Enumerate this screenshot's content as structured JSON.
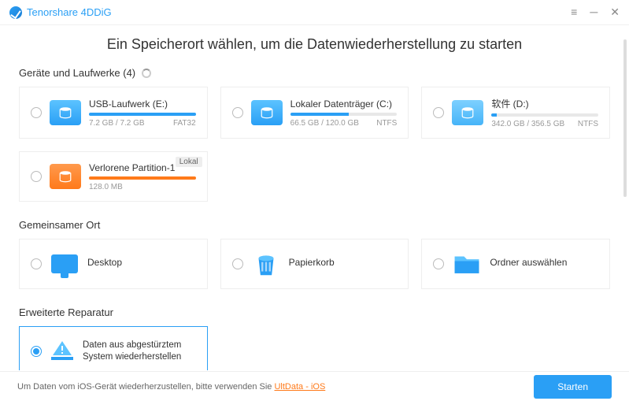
{
  "brand": "Tenorshare 4DDiG",
  "title": "Ein Speicherort wählen, um die Datenwiederherstellung zu starten",
  "sections": {
    "drives_head": "Geräte und Laufwerke (4)",
    "common_head": "Gemeinsamer Ort",
    "advanced_head": "Erweiterte Reparatur"
  },
  "drives": [
    {
      "name": "USB-Laufwerk (E:)",
      "size": "7.2 GB / 7.2 GB",
      "fs": "FAT32",
      "fill": 100,
      "color": "f-blue",
      "iconCls": "di-usb",
      "badge": ""
    },
    {
      "name": "Lokaler Datenträger (C:)",
      "size": "66.5 GB / 120.0 GB",
      "fs": "NTFS",
      "fill": 55,
      "color": "f-blue",
      "iconCls": "di-local",
      "badge": ""
    },
    {
      "name": "软件 (D:)",
      "size": "342.0 GB / 356.5 GB",
      "fs": "NTFS",
      "fill": 5,
      "color": "f-blue",
      "iconCls": "di-soft",
      "badge": ""
    },
    {
      "name": "Verlorene Partition-1",
      "size": "128.0 MB",
      "fs": "",
      "fill": 100,
      "color": "f-orange",
      "iconCls": "di-lost",
      "badge": "Lokal"
    }
  ],
  "common": [
    {
      "name": "Desktop",
      "icon": "monitor"
    },
    {
      "name": "Papierkorb",
      "icon": "trash"
    },
    {
      "name": "Ordner auswählen",
      "icon": "folder"
    }
  ],
  "advanced": {
    "text": "Daten aus abgestürztem System wiederherstellen",
    "selected": true
  },
  "footer": {
    "text_pre": "Um Daten vom iOS-Gerät wiederherzustellen, bitte verwenden Sie ",
    "link": "UltData - iOS",
    "start": "Starten"
  }
}
